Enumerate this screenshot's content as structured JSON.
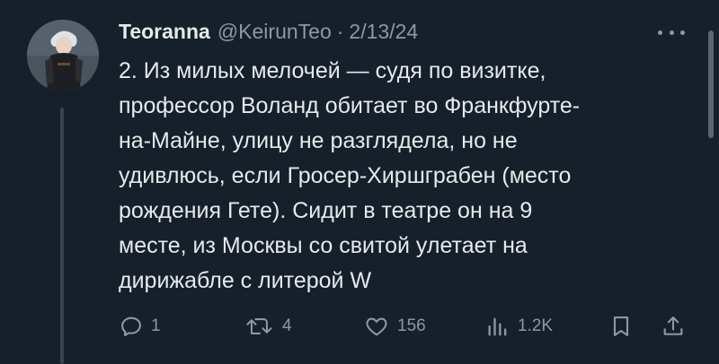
{
  "tweet": {
    "author_name": "Teoranna",
    "handle": "@KeirunTeo",
    "separator": "·",
    "date": "2/13/24",
    "text": "2. Из милых мелочей — судя по визитке,\nпрофессор Воланд обитает во Франкфурте-\nна-Майне, улицу не разглядела, но не\nудивлюсь, если Гросер-Хиршграбен (место\nрождения Гете). Сидит в театре он на 9\nместе, из Москвы со свитой улетает на\nдирижабле с литерой W"
  },
  "actions": {
    "reply": {
      "icon": "reply-icon",
      "count": "1"
    },
    "retweet": {
      "icon": "retweet-icon",
      "count": "4"
    },
    "like": {
      "icon": "heart-icon",
      "count": "156"
    },
    "views": {
      "icon": "views-icon",
      "count": "1.2K"
    },
    "bookmark": {
      "icon": "bookmark-icon"
    },
    "share": {
      "icon": "share-icon"
    }
  },
  "colors": {
    "background": "#15202b",
    "text": "#e7e9ea",
    "muted": "#8b98a5"
  }
}
